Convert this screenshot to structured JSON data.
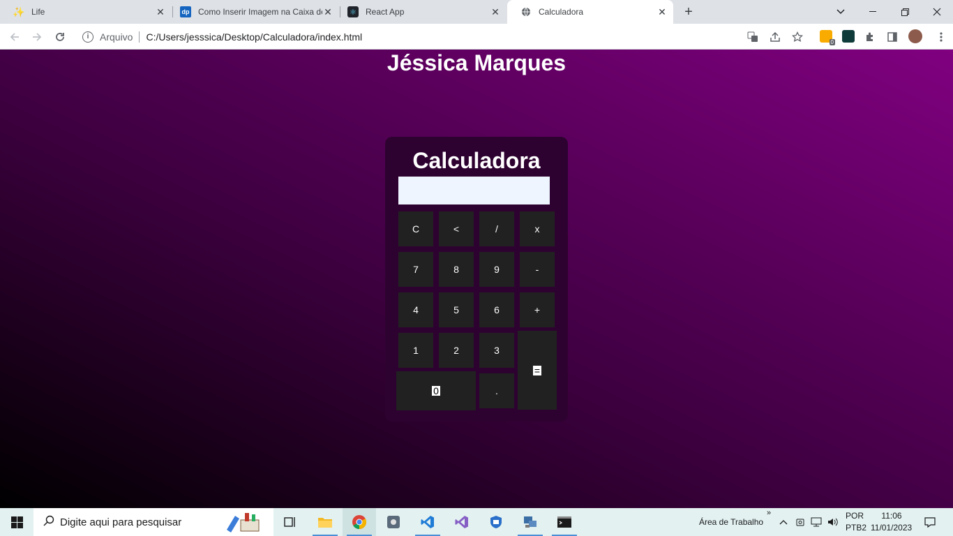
{
  "browser": {
    "tabs": [
      {
        "title": "Life",
        "icon": "sparkle-icon",
        "active": false
      },
      {
        "title": "Como Inserir Imagem na Caixa de",
        "icon": "dp-icon",
        "active": false
      },
      {
        "title": "React App",
        "icon": "react-icon",
        "active": false
      },
      {
        "title": "Calculadora",
        "icon": "globe-icon",
        "active": true
      }
    ],
    "new_tab_label": "+",
    "address": {
      "scheme_label": "Arquivo",
      "url": "C:/Users/jesssica/Desktop/Calculadora/index.html"
    },
    "extension_badge": "0"
  },
  "page": {
    "author_title": "Jéssica Marques",
    "calculator": {
      "title": "Calculadora",
      "display_value": "",
      "keys": {
        "clear": "C",
        "backspace": "<",
        "divide": "/",
        "multiply": "x",
        "seven": "7",
        "eight": "8",
        "nine": "9",
        "minus": "-",
        "four": "4",
        "five": "5",
        "six": "6",
        "plus": "+",
        "one": "1",
        "two": "2",
        "three": "3",
        "equals": "=",
        "zero": "0",
        "dot": "."
      }
    },
    "colors": {
      "gradient_start": "#000000",
      "gradient_end": "#800080",
      "calc_body": "#2e0230",
      "key_bg": "#212121",
      "display_bg": "#eef5ff"
    }
  },
  "taskbar": {
    "search_placeholder": "Digite aqui para pesquisar",
    "desktop_label": "Área de Trabalho",
    "desktop_chevron": "»",
    "language": "POR",
    "layout": "PTB2",
    "time": "11:06",
    "date": "11/01/2023"
  }
}
